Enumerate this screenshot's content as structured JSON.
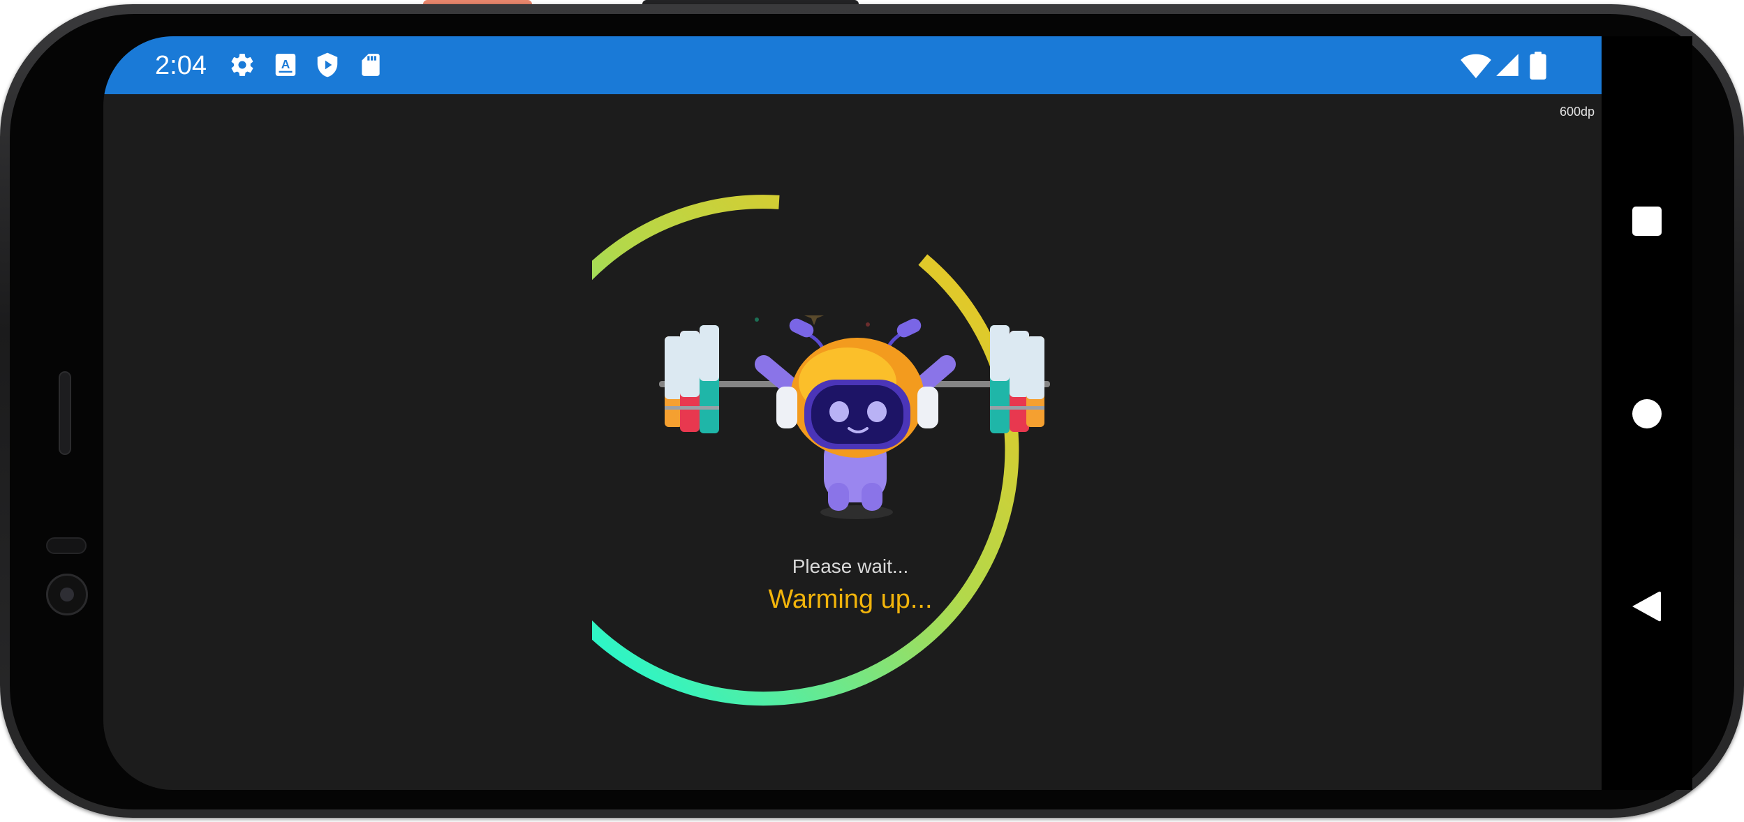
{
  "status_bar": {
    "time": "2:04",
    "left_icons": [
      "gear-icon",
      "translate-a-icon",
      "play-shield-icon",
      "sd-card-icon"
    ],
    "right_icons": [
      "wifi-icon",
      "cell-signal-icon",
      "battery-icon"
    ]
  },
  "screen": {
    "size_label": "600dp",
    "loader": {
      "wait_text": "Please wait...",
      "status_text": "Warming up..."
    }
  },
  "nav_bar": {
    "buttons": [
      "recents-square-icon",
      "home-circle-icon",
      "back-triangle-icon"
    ]
  },
  "colors": {
    "status_bar": "#1a7ad7",
    "screen_bg": "#1c1c1c",
    "status_text": "#f2b40b",
    "ring_gradient": [
      "#00fff0",
      "#b2d94b",
      "#f7c11a"
    ]
  }
}
